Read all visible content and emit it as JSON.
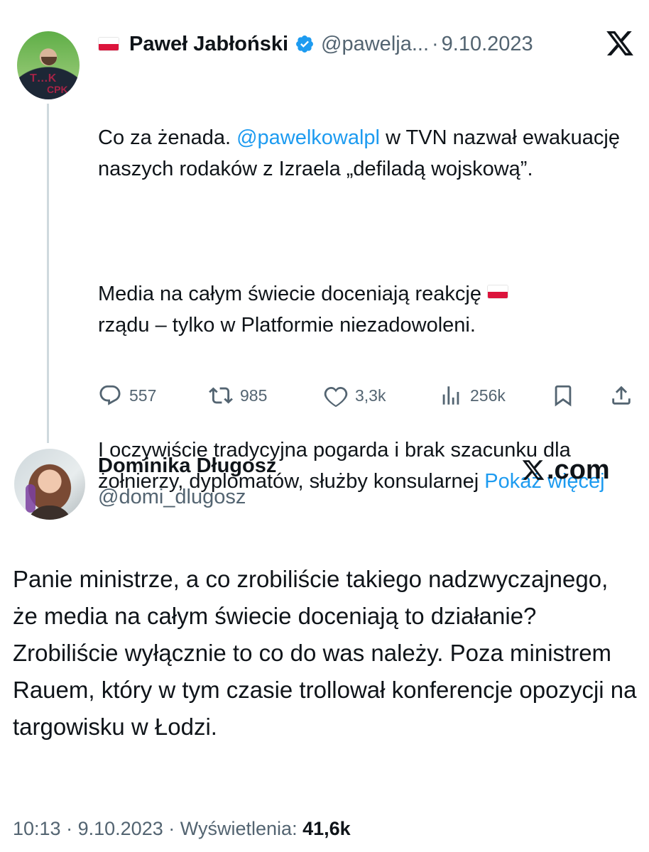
{
  "quoted_tweet": {
    "author_name": "Paweł Jabłoński",
    "handle": "@pawelja...",
    "date": "9.10.2023",
    "separator": "·",
    "flag_emoji": "polish-flag",
    "text": {
      "p1_before": "Co za żenada. ",
      "p1_mention": "@pawelkowalpl",
      "p1_after": " w TVN nazwał ewakuację naszych rodaków z Izraela „defiladą wojskową”.",
      "p2_before": "Media na całym świecie doceniają reakcję ",
      "p2_after": "rządu – tylko w Platformie niezadowoleni.",
      "p3": "I oczywiście tradycyjna pogarda i brak szacunku dla żołnierzy, dyplomatów, służby konsularnej ",
      "show_more": "Pokaż więcej"
    },
    "stats": {
      "replies": "557",
      "reposts": "985",
      "likes": "3,3k",
      "views": "256k"
    },
    "avatar_marks": [
      "T…K",
      "CPK"
    ]
  },
  "reply_tweet": {
    "author_name": "Dominika Długosz",
    "handle": "@domi_dlugosz",
    "source_brand": ".com",
    "text": "Panie ministrze, a co zrobiliście takiego nadzwyczajnego, że media na całym świecie doceniają to działanie? Zrobiliście wyłącznie to co do was należy. Poza ministrem Rauem, który w tym czasie trollował konferencje opozycji na targowisku w Łodzi.",
    "time": "10:13",
    "date": "9.10.2023",
    "views_label": "Wyświetlenia:",
    "views_count": "41,6k",
    "separator": "·"
  },
  "colors": {
    "accent": "#1d9bf0",
    "text": "#0f1419",
    "muted": "#536471",
    "thread_line": "#cfd9de",
    "flag_red": "#dc143c"
  },
  "icons": [
    "x-logo-icon",
    "verified-badge-icon",
    "reply-icon",
    "repost-icon",
    "like-icon",
    "views-icon",
    "bookmark-icon",
    "share-icon"
  ]
}
